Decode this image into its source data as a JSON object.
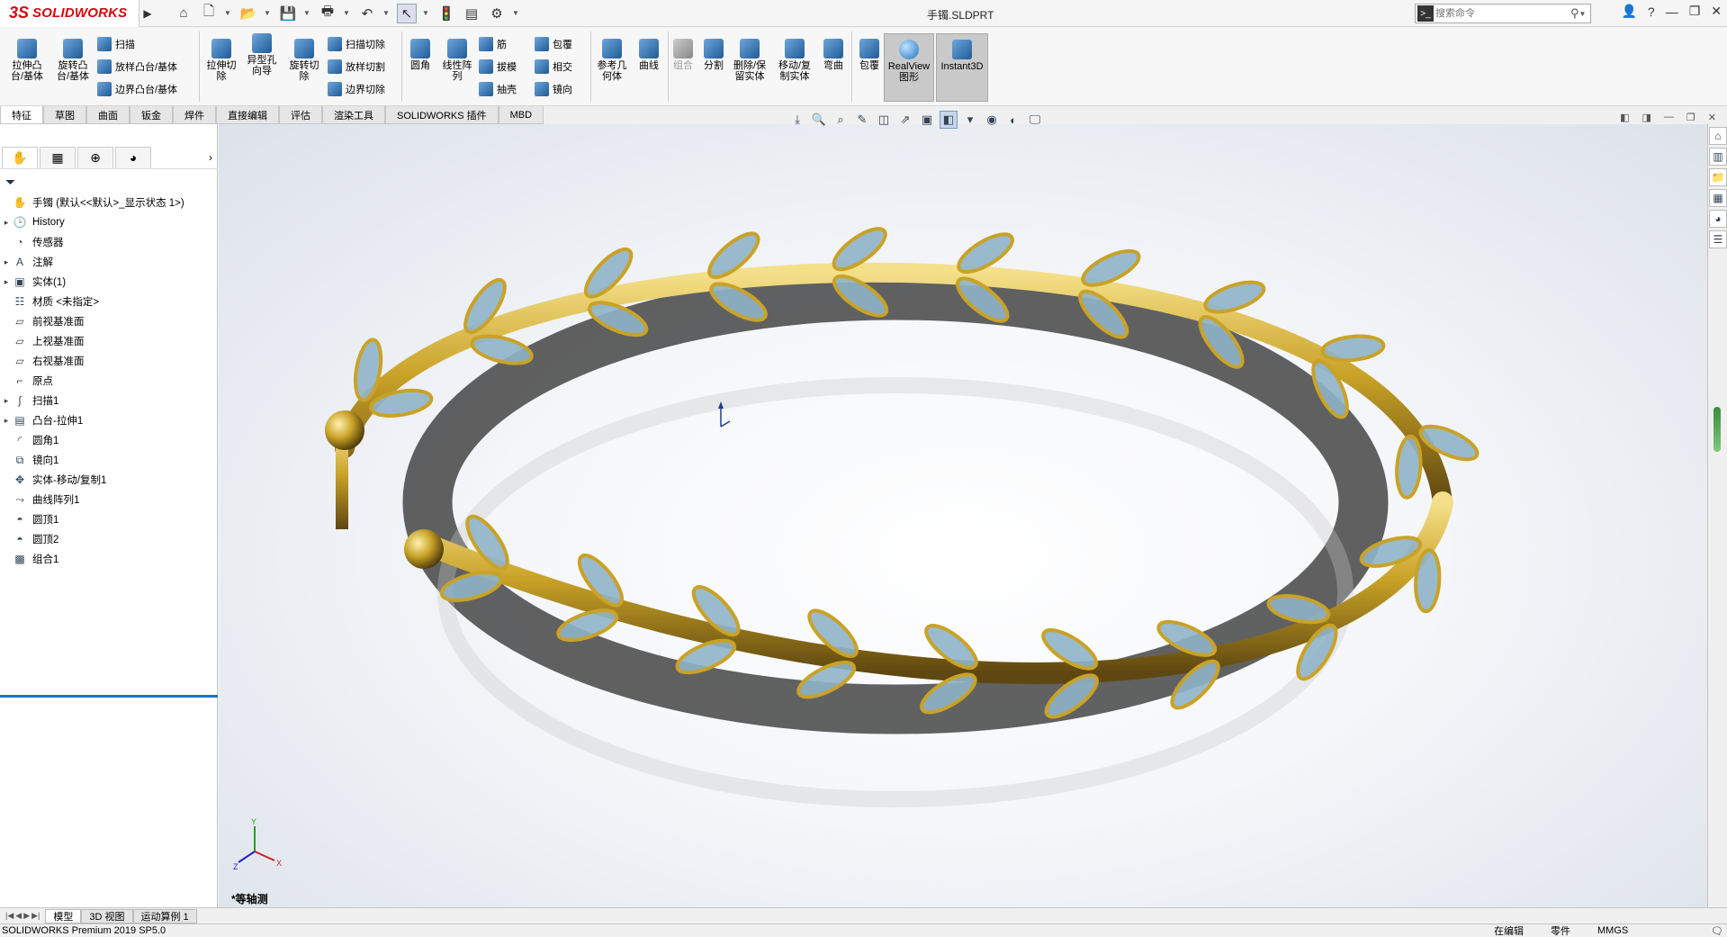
{
  "app": {
    "logo_mark": "3S",
    "logo_text": "SOLIDWORKS",
    "document_title": "手镯.SLDPRT"
  },
  "search": {
    "placeholder": "搜索命令"
  },
  "ribbon": {
    "big": [
      {
        "key": "extrude_boss",
        "label": "拉伸凸\n台/基体"
      },
      {
        "key": "revolve_boss",
        "label": "旋转凸\n台/基体"
      },
      {
        "key": "extrude_cut",
        "label": "拉伸切\n除"
      },
      {
        "key": "hole_wizard",
        "label": "异型孔\n向导"
      },
      {
        "key": "revolve_cut",
        "label": "旋转切\n除"
      },
      {
        "key": "fillet",
        "label": "圆角"
      },
      {
        "key": "linear_pattern",
        "label": "线性阵\n列"
      },
      {
        "key": "ref_geometry",
        "label": "参考几\n何体"
      },
      {
        "key": "curves",
        "label": "曲线"
      },
      {
        "key": "combine",
        "label": "组合"
      },
      {
        "key": "split",
        "label": "分割"
      },
      {
        "key": "delete_keep",
        "label": "删除/保\n留实体"
      },
      {
        "key": "move_copy",
        "label": "移动/复\n制实体"
      },
      {
        "key": "flex",
        "label": "弯曲"
      },
      {
        "key": "wrap",
        "label": "包覆"
      },
      {
        "key": "realview",
        "label": "RealView\n图形"
      },
      {
        "key": "instant3d",
        "label": "Instant3D"
      }
    ],
    "small": {
      "sweep": "扫描",
      "loft_boss": "放样凸台/基体",
      "boundary_boss": "边界凸台/基体",
      "swept_cut": "扫描切除",
      "lofted_cut": "放样切割",
      "boundary_cut": "边界切除",
      "rib": "筋",
      "draft": "拔模",
      "shell": "抽壳",
      "wrap": "包覆",
      "intersect": "相交",
      "mirror": "镜向"
    }
  },
  "command_tabs": [
    "特征",
    "草图",
    "曲面",
    "钣金",
    "焊件",
    "直接编辑",
    "评估",
    "渲染工具",
    "SOLIDWORKS 插件",
    "MBD"
  ],
  "active_command_tab": "特征",
  "feature_tree": [
    {
      "label": "手镯  (默认<<默认>_显示状态 1>)",
      "icon": "part-icon",
      "expand": false,
      "root": true
    },
    {
      "label": "History",
      "icon": "history-icon",
      "expand": true
    },
    {
      "label": "传感器",
      "icon": "sensor-icon",
      "expand": false
    },
    {
      "label": "注解",
      "icon": "annotation-icon",
      "expand": true
    },
    {
      "label": "实体(1)",
      "icon": "solid-bodies-icon",
      "expand": true
    },
    {
      "label": "材质 <未指定>",
      "icon": "material-icon",
      "expand": false
    },
    {
      "label": "前视基准面",
      "icon": "plane-icon",
      "expand": false
    },
    {
      "label": "上视基准面",
      "icon": "plane-icon",
      "expand": false
    },
    {
      "label": "右视基准面",
      "icon": "plane-icon",
      "expand": false
    },
    {
      "label": "原点",
      "icon": "origin-icon",
      "expand": false
    },
    {
      "label": "扫描1",
      "icon": "sweep-icon",
      "expand": true
    },
    {
      "label": "凸台-拉伸1",
      "icon": "extrude-icon",
      "expand": true
    },
    {
      "label": "圆角1",
      "icon": "fillet-icon",
      "expand": false
    },
    {
      "label": "镜向1",
      "icon": "mirror-icon",
      "expand": false
    },
    {
      "label": "实体-移动/复制1",
      "icon": "move-body-icon",
      "expand": false
    },
    {
      "label": "曲线阵列1",
      "icon": "curve-pattern-icon",
      "expand": false
    },
    {
      "label": "圆顶1",
      "icon": "dome-icon",
      "expand": false
    },
    {
      "label": "圆顶2",
      "icon": "dome-icon",
      "expand": false
    },
    {
      "label": "组合1",
      "icon": "combine-icon",
      "expand": false
    }
  ],
  "viewport": {
    "view_name": "*等轴测",
    "triad": {
      "x": "X",
      "y": "Y",
      "z": "Z"
    }
  },
  "bottom_tabs": [
    "模型",
    "3D 视图",
    "运动算例 1"
  ],
  "active_bottom_tab": "模型",
  "status": {
    "product": "SOLIDWORKS Premium 2019 SP5.0",
    "editing": "在编辑",
    "mode": "零件",
    "units": "MMGS"
  },
  "colors": {
    "brand": "#d10a10",
    "gold": "#c9a227",
    "leaf": "#8fb4c8",
    "rollback": "#1e73be"
  }
}
